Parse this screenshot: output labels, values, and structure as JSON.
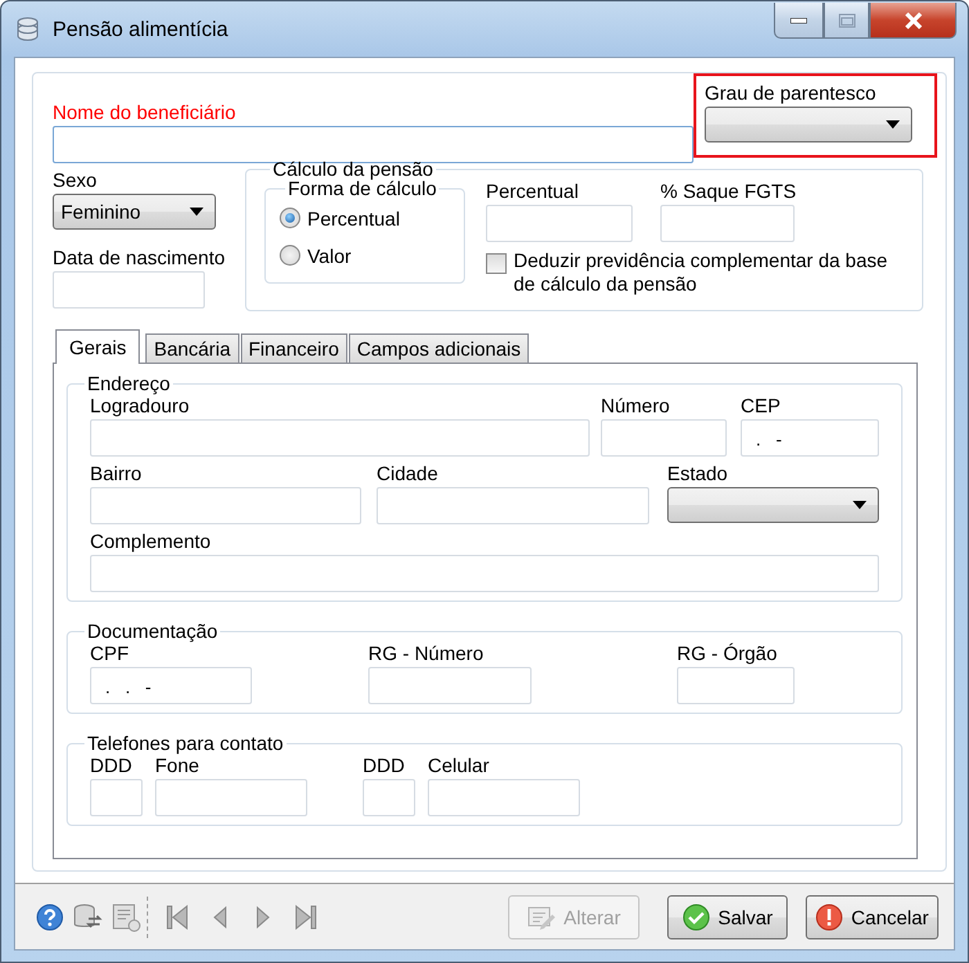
{
  "window": {
    "title": "Pensão alimentícia"
  },
  "beneficiary": {
    "label": "Nome do beneficiário",
    "required": true
  },
  "relationship": {
    "label": "Grau de parentesco",
    "highlighted": true
  },
  "sex": {
    "label": "Sexo",
    "value": "Feminino"
  },
  "birth_date": {
    "label": "Data de nascimento"
  },
  "calculation": {
    "title": "Cálculo da pensão",
    "method": {
      "title": "Forma de cálculo",
      "options": [
        {
          "label": "Percentual",
          "selected": true
        },
        {
          "label": "Valor",
          "selected": false
        }
      ]
    },
    "fields": [
      {
        "label": "Percentual"
      },
      {
        "label": "% Saque FGTS"
      }
    ],
    "deduct": {
      "label": "Deduzir previdência complementar da base de cálculo da pensão",
      "checked": false
    }
  },
  "tabs": [
    {
      "label": "Gerais",
      "selected": true
    },
    {
      "label": "Bancária",
      "selected": false
    },
    {
      "label": "Financeiro",
      "selected": false
    },
    {
      "label": "Campos adicionais",
      "selected": false
    }
  ],
  "sections": [
    {
      "title": "Endereço",
      "rows": [
        [
          {
            "label": "Logradouro",
            "kind": "text"
          },
          {
            "label": "Número",
            "kind": "text"
          },
          {
            "label": "CEP",
            "kind": "text",
            "value": ".   -"
          }
        ],
        [
          {
            "label": "Bairro",
            "kind": "text"
          },
          {
            "label": "Cidade",
            "kind": "text"
          },
          {
            "label": "Estado",
            "kind": "select"
          }
        ],
        [
          {
            "label": "Complemento",
            "kind": "text"
          }
        ]
      ]
    },
    {
      "title": "Documentação",
      "rows": [
        [
          {
            "label": "CPF",
            "kind": "text",
            "value": ".   .   -"
          },
          {
            "label": "RG - Número",
            "kind": "text"
          },
          {
            "label": "RG - Órgão",
            "kind": "text"
          }
        ]
      ]
    },
    {
      "title": "Telefones para contato",
      "rows": [
        [
          {
            "label": "DDD",
            "kind": "text"
          },
          {
            "label": "Fone",
            "kind": "text"
          },
          {
            "label": "DDD",
            "kind": "text"
          },
          {
            "label": "Celular",
            "kind": "text"
          }
        ]
      ]
    }
  ],
  "buttons": [
    {
      "label": "Alterar",
      "kind": "edit",
      "disabled": true
    },
    {
      "label": "Salvar",
      "kind": "ok",
      "disabled": false
    },
    {
      "label": "Cancelar",
      "kind": "cancel",
      "disabled": false
    }
  ]
}
